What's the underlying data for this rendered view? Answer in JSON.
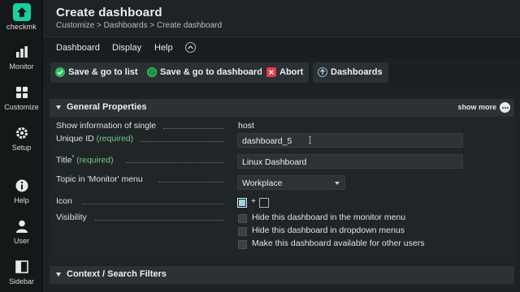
{
  "app": {
    "brand": "checkmk",
    "brand_color": "#15d1a0"
  },
  "sidebar": {
    "items": [
      {
        "label": "Monitor",
        "icon": "bar-chart-icon"
      },
      {
        "label": "Customize",
        "icon": "grid-icon"
      },
      {
        "label": "Setup",
        "icon": "gear-icon"
      },
      {
        "label": "Help",
        "icon": "help-icon"
      },
      {
        "label": "User",
        "icon": "user-icon"
      },
      {
        "label": "Sidebar",
        "icon": "sidebar-icon"
      }
    ]
  },
  "header": {
    "title": "Create dashboard",
    "breadcrumb": [
      "Customize",
      "Dashboards",
      "Create dashboard"
    ],
    "separator": ">"
  },
  "menubar": {
    "items": [
      "Dashboard",
      "Display",
      "Help"
    ],
    "toggle_icon": "chevron-up-icon"
  },
  "toolbar": {
    "buttons": [
      {
        "label": "Save & go to list",
        "icon": "save-check-icon",
        "color": "#2fbf5b"
      },
      {
        "label": "Save & go to dashboard",
        "icon": "save-globe-icon",
        "color": "#2fbf5b"
      },
      {
        "label": "Abort",
        "icon": "abort-icon",
        "color": "#e8364a"
      },
      {
        "label": "Dashboards",
        "icon": "dashboards-icon",
        "color": "#4a90c8"
      }
    ]
  },
  "general": {
    "title": "General Properties",
    "show_more": "show more",
    "rows": {
      "show_info": {
        "label": "Show information of single",
        "value": "host"
      },
      "unique_id": {
        "label": "Unique ID",
        "required": "(required)",
        "value": "dashboard_5"
      },
      "title": {
        "label": "Title",
        "required": "(required)",
        "marker": "*",
        "value": "Linux Dashboard"
      },
      "topic": {
        "label": "Topic in 'Monitor' menu",
        "value": "Workplace"
      },
      "icon": {
        "label": "Icon",
        "plus": "+"
      },
      "visibility": {
        "label": "Visibility",
        "options": [
          "Hide this dashboard in the monitor menu",
          "Hide this dashboard in dropdown menus",
          "Make this dashboard available for other users"
        ]
      }
    }
  },
  "context": {
    "title": "Context / Search Filters"
  }
}
